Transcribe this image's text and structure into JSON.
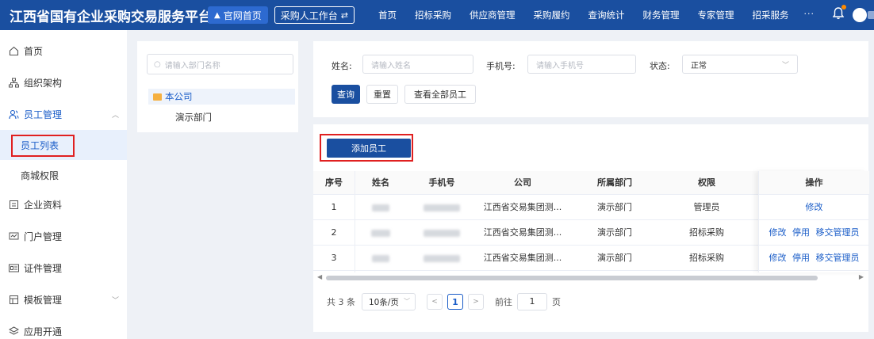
{
  "header": {
    "title": "江西省国有企业采购交易服务平台",
    "home_button": "官网首页",
    "workbench_button": "采购人工作台",
    "nav": [
      "首页",
      "招标采购",
      "供应商管理",
      "采购履约",
      "查询统计",
      "财务管理",
      "专家管理",
      "招采服务"
    ],
    "more": "···",
    "icons": {
      "home": "home-icon",
      "swap": "swap-icon",
      "bell": "bell-icon",
      "avatar": "avatar"
    }
  },
  "sidebar": {
    "items": [
      {
        "label": "首页",
        "icon": "home-icon"
      },
      {
        "label": "组织架构",
        "icon": "org-chart-icon"
      },
      {
        "label": "员工管理",
        "icon": "users-icon",
        "expanded": true
      },
      {
        "label": "企业资料",
        "icon": "document-icon"
      },
      {
        "label": "门户管理",
        "icon": "portal-icon"
      },
      {
        "label": "证件管理",
        "icon": "id-card-icon"
      },
      {
        "label": "模板管理",
        "icon": "template-icon"
      },
      {
        "label": "应用开通",
        "icon": "app-icon"
      }
    ],
    "sub_items": [
      {
        "label": "员工列表",
        "active": true
      },
      {
        "label": "商城权限"
      }
    ]
  },
  "dept_tree": {
    "search_placeholder": "请输入部门名称",
    "nodes": [
      "本公司",
      "演示部门"
    ]
  },
  "filters": {
    "name_label": "姓名:",
    "name_placeholder": "请输入姓名",
    "phone_label": "手机号:",
    "phone_placeholder": "请输入手机号",
    "status_label": "状态:",
    "status_value": "正常",
    "query_button": "查询",
    "reset_button": "重置",
    "view_all_button": "查看全部员工"
  },
  "table": {
    "add_button": "添加员工",
    "columns": [
      "序号",
      "姓名",
      "手机号",
      "公司",
      "所属部门",
      "权限",
      "操作"
    ],
    "rows": [
      {
        "index": "1",
        "company": "江西省交易集团测...",
        "dept": "演示部门",
        "role": "管理员",
        "actions": [
          "修改"
        ]
      },
      {
        "index": "2",
        "company": "江西省交易集团测...",
        "dept": "演示部门",
        "role": "招标采购",
        "actions": [
          "修改",
          "停用",
          "移交管理员"
        ]
      },
      {
        "index": "3",
        "company": "江西省交易集团测...",
        "dept": "演示部门",
        "role": "招标采购",
        "actions": [
          "修改",
          "停用",
          "移交管理员"
        ]
      }
    ]
  },
  "pagination": {
    "total": "共 3 条",
    "page_size": "10条/页",
    "current_page": "1",
    "goto_prefix": "前往",
    "goto_value": "1",
    "goto_suffix": "页"
  },
  "colors": {
    "primary": "#1a4fa0",
    "accent": "#1a5dc8",
    "highlight": "#e02020"
  }
}
